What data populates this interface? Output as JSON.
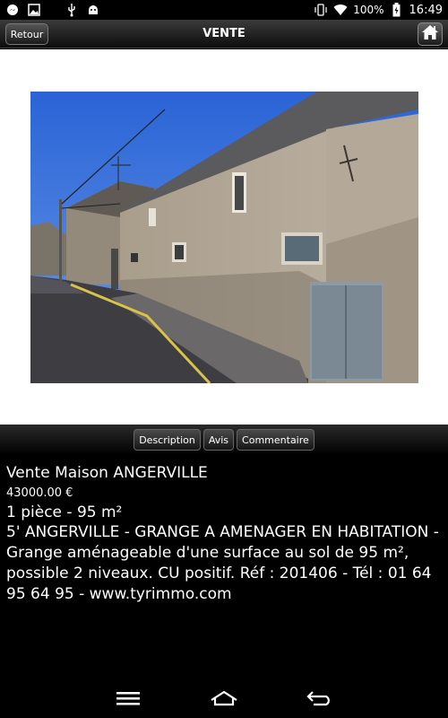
{
  "status_bar": {
    "battery": "100%",
    "time": "16:49",
    "icons": [
      "messenger-icon",
      "image-icon",
      "usb-icon",
      "android-debug-icon",
      "vibrate-icon",
      "wifi-icon",
      "battery-icon"
    ]
  },
  "header": {
    "back_label": "Retour",
    "title": "VENTE",
    "home_icon": "home-icon"
  },
  "tabs": [
    {
      "label": "Description",
      "active": true
    },
    {
      "label": "Avis",
      "active": false
    },
    {
      "label": "Commentaire",
      "active": false
    }
  ],
  "listing": {
    "title": "Vente Maison ANGERVILLE",
    "price": "43000.00 €",
    "rooms": "1 pièce - 95 m²",
    "description": "5' ANGERVILLE - GRANGE A AMENAGER EN HABITATION - Grange aménageable d'une surface au sol de 95 m², possible 2 niveaux. CU positif. Réf : 201406 - Tél : 01 64 95 64 95 - www.tyrimmo.com"
  },
  "nav_bar": {
    "icons": [
      "menu-icon",
      "home-outline-icon",
      "back-arrow-icon"
    ]
  },
  "colors": {
    "background": "#000000",
    "photo_area": "#ffffff",
    "sky": "#3a72d8",
    "wall": "#a89f90"
  }
}
